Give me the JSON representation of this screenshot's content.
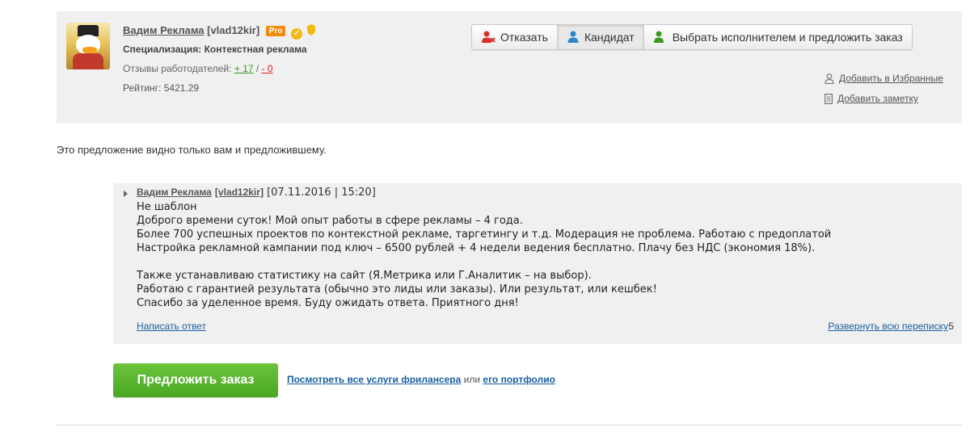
{
  "profile": {
    "name": "Вадим Реклама",
    "login": "[vlad12kir]",
    "pro_badge": "Pro",
    "specialization": "Специализация: Контекстная реклама",
    "reviews_label": "Отзывы работодателей:",
    "reviews_positive": "+ 17",
    "reviews_separator": "/",
    "reviews_negative": "- 0",
    "rating": "Рейтинг: 5421.29"
  },
  "actions": {
    "reject": "Отказать",
    "candidate": "Кандидат",
    "choose": "Выбрать исполнителем и предложить заказ"
  },
  "side_links": {
    "favorites": "Добавить в Избранные",
    "note": "Добавить заметку"
  },
  "visibility_note": "Это предложение видно только вам и предложившему.",
  "message": {
    "author": "Вадим Реклама",
    "login": "[vlad12kir]",
    "datetime": "[07.11.2016 | 15:20]",
    "lines": [
      "Не шаблон",
      "Доброго времени суток! Мой опыт работы в сфере рекламы – 4 года.",
      "Более 700 успешных проектов по контекстной рекламе, таргетингу и т.д. Модерация не проблема. Работаю с предоплатой",
      "Настройка рекламной кампании под ключ – 6500 рублей + 4 недели ведения бесплатно. Плачу без НДС (экономия 18%).",
      "",
      "Также устанавливаю статистику на сайт (Я.Метрика или Г.Аналитик – на выбор).",
      "Работаю с гарантией результата (обычно это лиды или заказы). Или результат, или кешбек!",
      "Спасибо за уделенное время. Буду ожидать ответа. Приятного дня!"
    ],
    "reply_link": "Написать ответ",
    "expand_link": "Развернуть всю переписку",
    "expand_count": "5"
  },
  "footer": {
    "offer_button": "Предложить заказ",
    "services_link": "Посмотреть все услуги фрилансера",
    "or_text": "или",
    "portfolio_link": "его портфолио"
  },
  "colors": {
    "card_bg": "#f0f0f0",
    "link_blue": "#1a5fa0",
    "green_button": "#4aa624",
    "pro_orange": "#f28a0c",
    "reject_red": "#d9302a",
    "candidate_blue": "#2d86c9",
    "choose_green": "#3a9a1e"
  }
}
